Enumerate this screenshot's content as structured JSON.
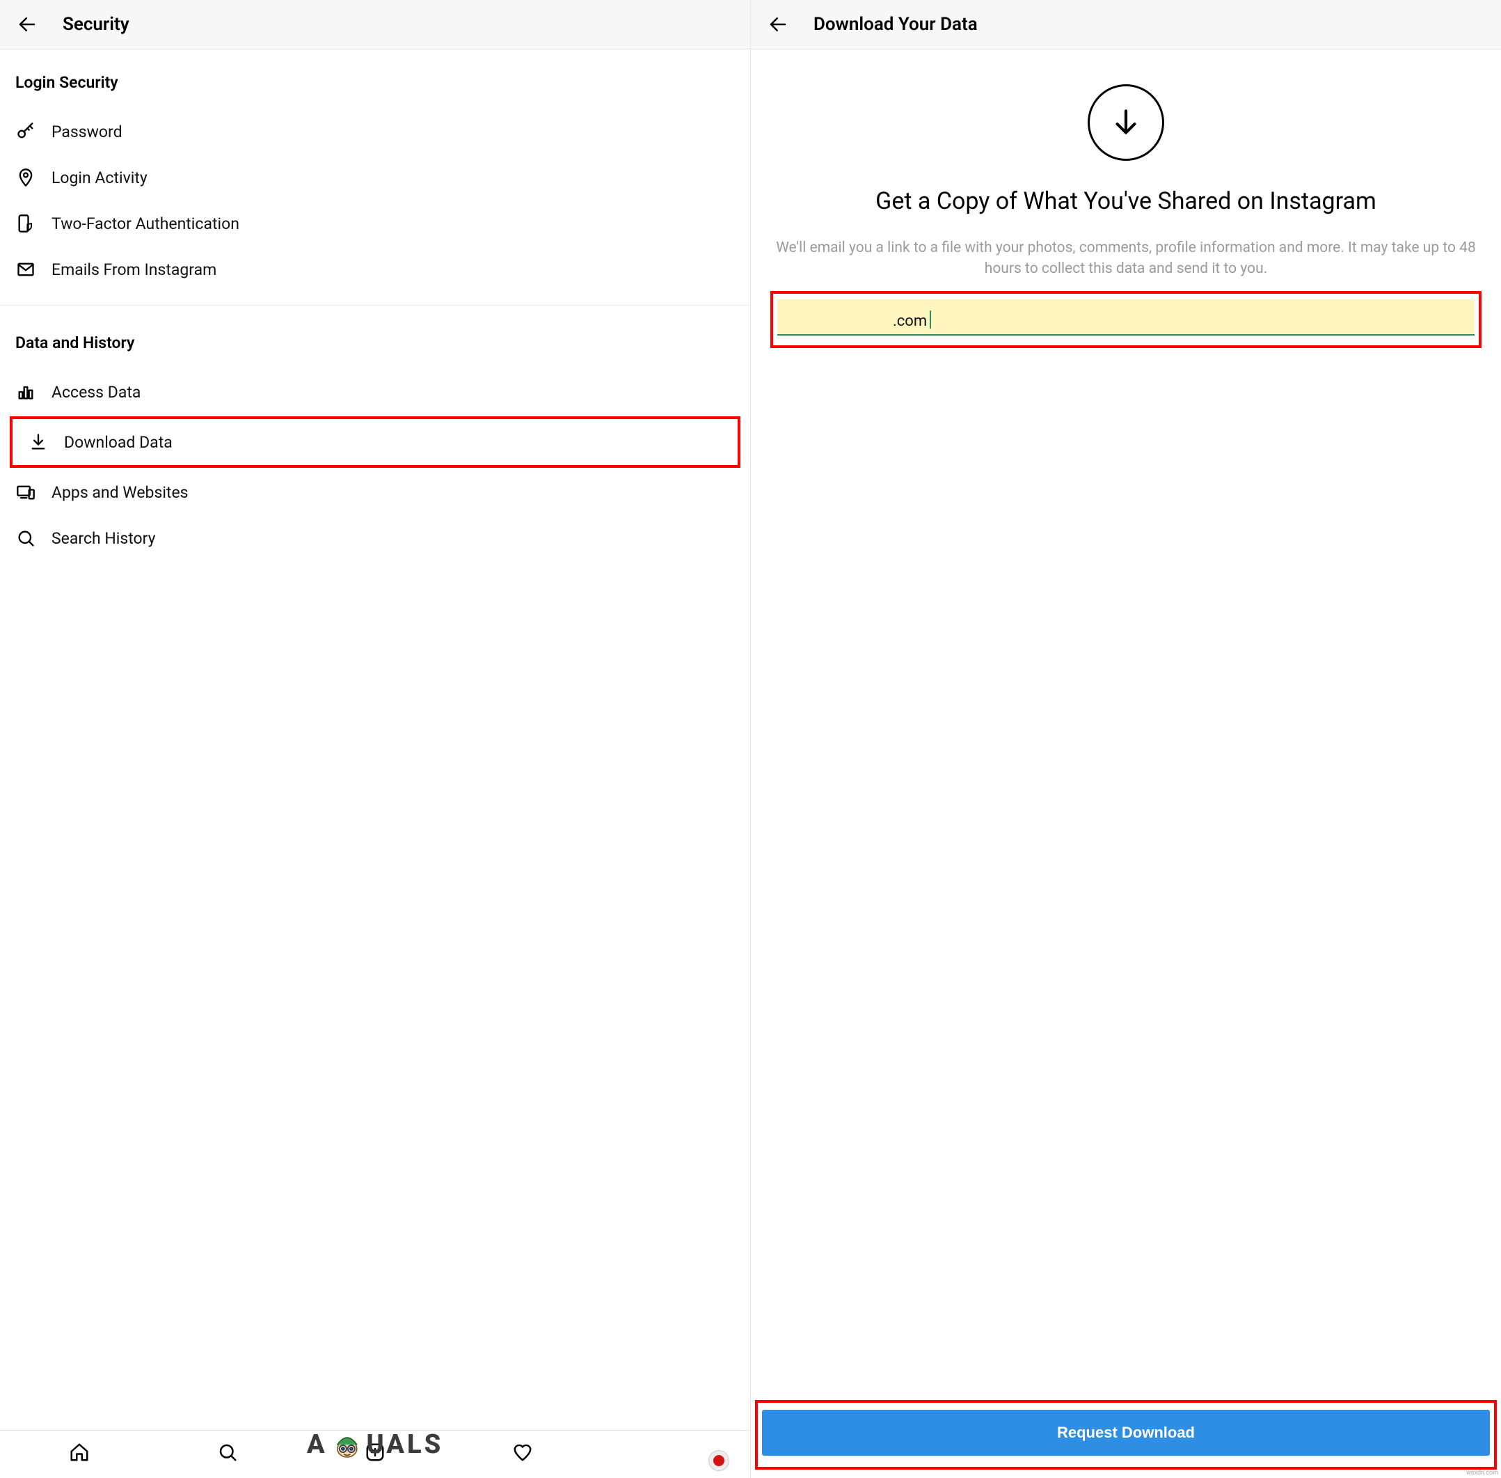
{
  "left": {
    "header_title": "Security",
    "sections": {
      "login_security": {
        "title": "Login Security",
        "items": {
          "password": "Password",
          "login_activity": "Login Activity",
          "two_factor": "Two-Factor Authentication",
          "emails": "Emails From Instagram"
        }
      },
      "data_history": {
        "title": "Data and History",
        "items": {
          "access_data": "Access Data",
          "download_data": "Download Data",
          "apps_websites": "Apps and Websites",
          "search_history": "Search History"
        }
      }
    }
  },
  "right": {
    "header_title": "Download Your Data",
    "heading": "Get a Copy of What You've Shared on Instagram",
    "description": "We'll email you a link to a file with your photos, comments, profile information and more. It may take up to 48 hours to collect this data and send it to you.",
    "email_suffix": ".com",
    "request_button": "Request Download"
  },
  "watermark": "A  UALS",
  "site_credit": "wsxdn.com"
}
